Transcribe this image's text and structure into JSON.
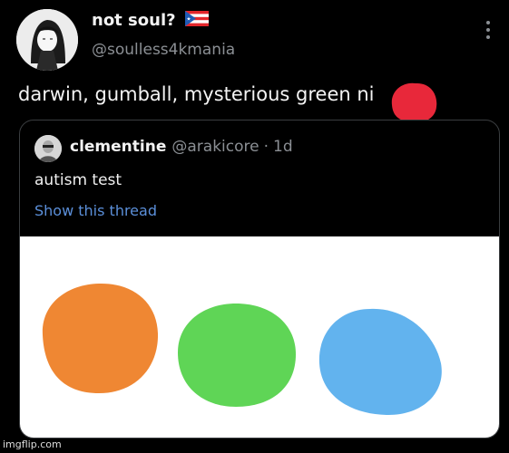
{
  "tweet": {
    "display_name": "not soul?",
    "flag_icon": "puerto-rico-flag-icon",
    "handle": "@soulless4kmania",
    "text": "darwin, gumball, mysterious green ni",
    "redaction_color": "#e8283a"
  },
  "quote": {
    "display_name": "clementine",
    "handle": "@arakicore",
    "separator": "·",
    "time": "1d",
    "text": "autism test",
    "show_thread_label": "Show this thread",
    "link_color": "#5b8fd9"
  },
  "media": {
    "background": "#ffffff",
    "dots": [
      {
        "name": "orange-dot",
        "color": "#ef8733"
      },
      {
        "name": "green-dot",
        "color": "#5fd556"
      },
      {
        "name": "blue-dot",
        "color": "#62b3ee"
      }
    ]
  },
  "watermark": "imgflip.com"
}
